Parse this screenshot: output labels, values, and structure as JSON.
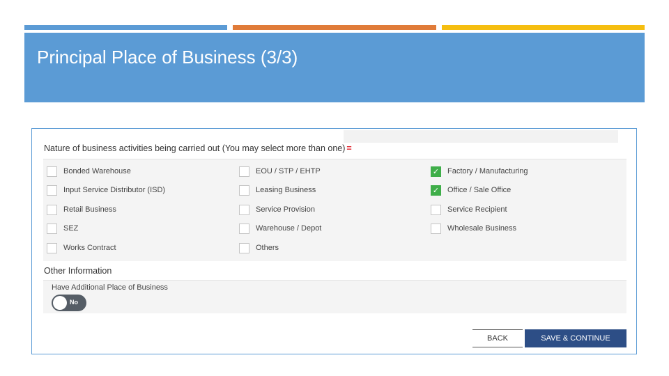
{
  "slide": {
    "title": "Principal Place of Business (3/3)",
    "accent_colors": [
      "#5b9bd5",
      "#e07b39",
      "#f5be10"
    ]
  },
  "form": {
    "nature_heading": "Nature of business activities being carried out (You may select more than one)",
    "required_marker": "=",
    "activities": [
      {
        "label": "Bonded Warehouse",
        "checked": false
      },
      {
        "label": "EOU / STP / EHTP",
        "checked": false
      },
      {
        "label": "Factory / Manufacturing",
        "checked": true
      },
      {
        "label": "Input Service Distributor (ISD)",
        "checked": false
      },
      {
        "label": "Leasing Business",
        "checked": false
      },
      {
        "label": "Office / Sale Office",
        "checked": true
      },
      {
        "label": "Retail Business",
        "checked": false
      },
      {
        "label": "Service Provision",
        "checked": false
      },
      {
        "label": "Service Recipient",
        "checked": false
      },
      {
        "label": "SEZ",
        "checked": false
      },
      {
        "label": "Warehouse / Depot",
        "checked": false
      },
      {
        "label": "Wholesale Business",
        "checked": false
      },
      {
        "label": "Works Contract",
        "checked": false
      },
      {
        "label": "Others",
        "checked": false
      }
    ],
    "other_info_heading": "Other Information",
    "additional_place_label": "Have Additional Place of Business",
    "additional_place_toggle": "No",
    "check_glyph": "✓"
  },
  "buttons": {
    "back": "BACK",
    "save_continue": "SAVE & CONTINUE"
  }
}
